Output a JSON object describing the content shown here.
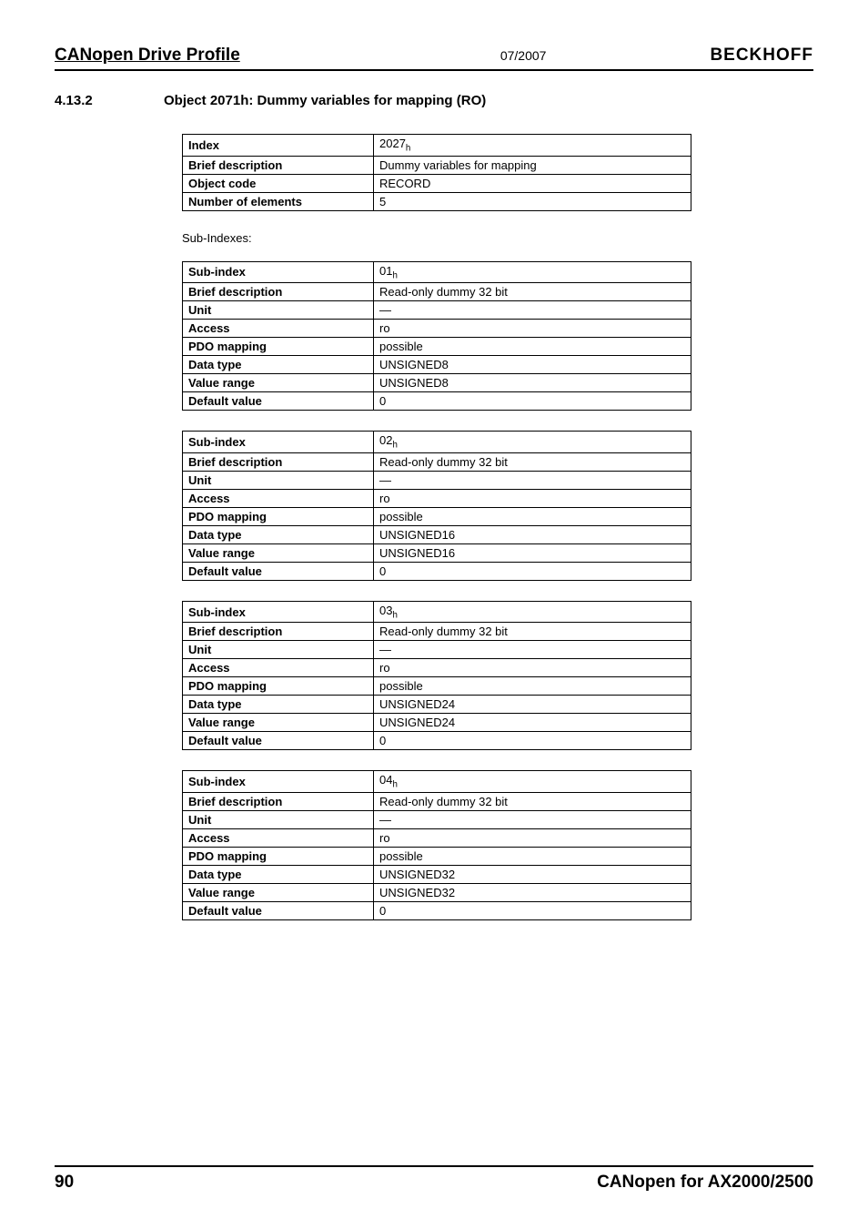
{
  "header": {
    "left": "CANopen Drive Profile",
    "mid": "07/2007",
    "right": "BECKHOFF"
  },
  "section": {
    "num": "4.13.2",
    "title": "Object 2071h: Dummy variables for mapping (RO)"
  },
  "mainTable": {
    "rows": [
      {
        "label": "Index",
        "value": "2027",
        "sub": "h"
      },
      {
        "label": "Brief description",
        "value": "Dummy variables for mapping"
      },
      {
        "label": "Object code",
        "value": "RECORD"
      },
      {
        "label": "Number of elements",
        "value": "5"
      }
    ]
  },
  "subLabel": "Sub-Indexes:",
  "subTables": [
    {
      "rows": [
        {
          "label": "Sub-index",
          "value": "01",
          "sub": "h"
        },
        {
          "label": "Brief description",
          "value": "Read-only dummy 32 bit"
        },
        {
          "label": "Unit",
          "value": "—"
        },
        {
          "label": "Access",
          "value": "ro"
        },
        {
          "label": "PDO mapping",
          "value": "possible"
        },
        {
          "label": "Data type",
          "value": "UNSIGNED8"
        },
        {
          "label": "Value range",
          "value": "UNSIGNED8"
        },
        {
          "label": "Default value",
          "value": "0"
        }
      ]
    },
    {
      "rows": [
        {
          "label": "Sub-index",
          "value": "02",
          "sub": "h"
        },
        {
          "label": "Brief description",
          "value": "Read-only dummy 32 bit"
        },
        {
          "label": "Unit",
          "value": "—"
        },
        {
          "label": "Access",
          "value": "ro"
        },
        {
          "label": "PDO mapping",
          "value": "possible"
        },
        {
          "label": "Data type",
          "value": "UNSIGNED16"
        },
        {
          "label": "Value range",
          "value": "UNSIGNED16"
        },
        {
          "label": "Default value",
          "value": "0"
        }
      ]
    },
    {
      "rows": [
        {
          "label": "Sub-index",
          "value": "03",
          "sub": "h"
        },
        {
          "label": "Brief description",
          "value": "Read-only dummy 32 bit"
        },
        {
          "label": "Unit",
          "value": "—"
        },
        {
          "label": "Access",
          "value": "ro"
        },
        {
          "label": "PDO mapping",
          "value": "possible"
        },
        {
          "label": "Data type",
          "value": "UNSIGNED24"
        },
        {
          "label": "Value range",
          "value": "UNSIGNED24"
        },
        {
          "label": "Default value",
          "value": "0"
        }
      ]
    },
    {
      "rows": [
        {
          "label": "Sub-index",
          "value": "04",
          "sub": "h"
        },
        {
          "label": "Brief description",
          "value": "Read-only dummy 32 bit"
        },
        {
          "label": "Unit",
          "value": "—"
        },
        {
          "label": "Access",
          "value": "ro"
        },
        {
          "label": "PDO mapping",
          "value": "possible"
        },
        {
          "label": "Data type",
          "value": "UNSIGNED32"
        },
        {
          "label": "Value range",
          "value": "UNSIGNED32"
        },
        {
          "label": "Default value",
          "value": "0"
        }
      ]
    }
  ],
  "footer": {
    "left": "90",
    "right": "CANopen for AX2000/2500"
  }
}
